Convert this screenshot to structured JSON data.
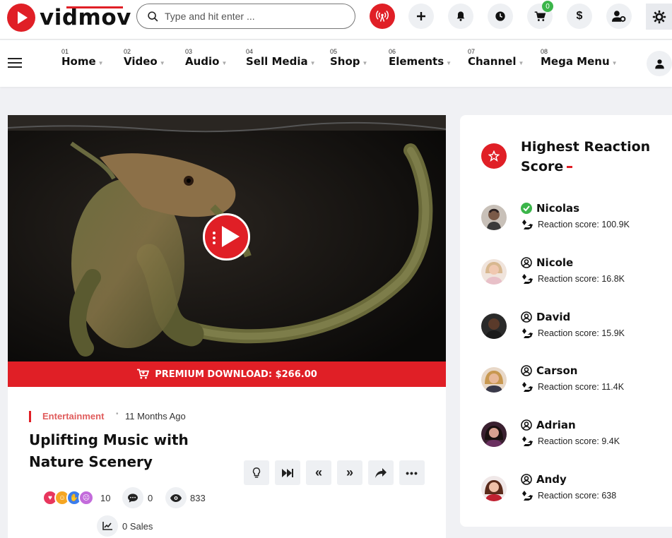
{
  "brand": {
    "name": "vidmov"
  },
  "search": {
    "placeholder": "Type and hit enter ..."
  },
  "topbar": {
    "cart_count": "0"
  },
  "nav": {
    "items": [
      {
        "num": "01",
        "label": "Home"
      },
      {
        "num": "02",
        "label": "Video"
      },
      {
        "num": "03",
        "label": "Audio"
      },
      {
        "num": "04",
        "label": "Sell Media"
      },
      {
        "num": "05",
        "label": "Shop"
      },
      {
        "num": "06",
        "label": "Elements"
      },
      {
        "num": "07",
        "label": "Channel"
      },
      {
        "num": "08",
        "label": "Mega Menu"
      }
    ]
  },
  "video": {
    "premium_label": "PREMIUM DOWNLOAD: $266.00",
    "category": "Entertainment",
    "date": "11 Months Ago",
    "title": "Uplifting Music with Nature Scenery",
    "reactions": "10",
    "comments": "0",
    "views": "833",
    "sales": "0 Sales"
  },
  "sidebar": {
    "title": "Highest Reaction Score",
    "items": [
      {
        "name": "Nicolas",
        "verified": true,
        "score": "Reaction score: 100.9K"
      },
      {
        "name": "Nicole",
        "verified": false,
        "score": "Reaction score: 16.8K"
      },
      {
        "name": "David",
        "verified": false,
        "score": "Reaction score: 15.9K"
      },
      {
        "name": "Carson",
        "verified": false,
        "score": "Reaction score: 11.4K"
      },
      {
        "name": "Adrian",
        "verified": false,
        "score": "Reaction score: 9.4K"
      },
      {
        "name": "Andy",
        "verified": false,
        "score": "Reaction score: 638"
      }
    ]
  },
  "colors": {
    "accent": "#e01f26",
    "verified": "#3bb54a"
  },
  "icons": [
    "search-icon",
    "live-icon",
    "plus-icon",
    "bell-icon",
    "clock-icon",
    "cart-icon",
    "dollar-icon",
    "user-settings-icon",
    "gear-icon",
    "menu-icon",
    "user-icon",
    "play-icon",
    "idea-icon",
    "skip-icon",
    "rewind-icon",
    "forward-icon",
    "share-icon",
    "more-icon",
    "comment-icon",
    "eye-icon",
    "chart-icon",
    "star-icon",
    "hand-icon"
  ]
}
